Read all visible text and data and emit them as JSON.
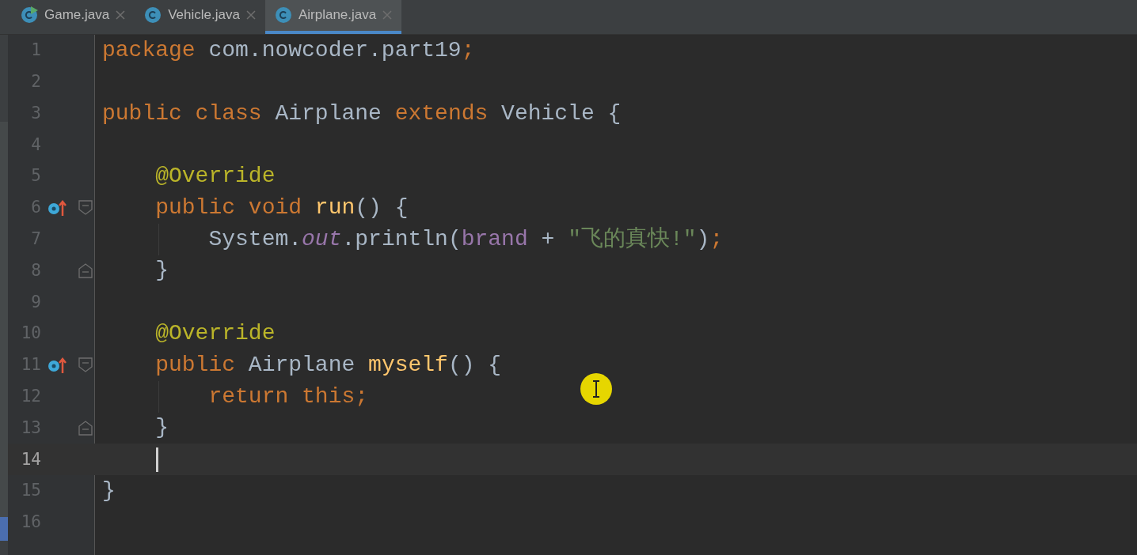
{
  "tabs": [
    {
      "label": "Game.java",
      "kind": "runnable",
      "selected": false
    },
    {
      "label": "Vehicle.java",
      "kind": "class",
      "selected": false
    },
    {
      "label": "Airplane.java",
      "kind": "class",
      "selected": true
    }
  ],
  "editor": {
    "lines": [
      {
        "number": "1",
        "tokens": [
          {
            "text": "package ",
            "kind": "keyword"
          },
          {
            "text": "com.nowcoder.part19",
            "kind": "plain"
          },
          {
            "text": ";",
            "kind": "keyword"
          }
        ]
      },
      {
        "number": "2"
      },
      {
        "number": "3",
        "tokens": [
          {
            "text": "public class ",
            "kind": "keyword"
          },
          {
            "text": "Airplane ",
            "kind": "plain"
          },
          {
            "text": "extends ",
            "kind": "keyword"
          },
          {
            "text": "Vehicle {",
            "kind": "plain"
          }
        ]
      },
      {
        "number": "4"
      },
      {
        "number": "5",
        "tokens": [
          {
            "text": "    @Override",
            "kind": "annotation"
          }
        ]
      },
      {
        "number": "6",
        "override": true,
        "fold_open": true,
        "tokens": [
          {
            "text": "    public void ",
            "kind": "keyword"
          },
          {
            "text": "run",
            "kind": "method"
          },
          {
            "text": "() {",
            "kind": "plain"
          }
        ]
      },
      {
        "number": "7",
        "guide": true,
        "tokens": [
          {
            "text": "        System.",
            "kind": "plain"
          },
          {
            "text": "out",
            "kind": "static"
          },
          {
            "text": ".println(",
            "kind": "plain"
          },
          {
            "text": "brand",
            "kind": "field"
          },
          {
            "text": " + ",
            "kind": "plain"
          },
          {
            "text": "\"飞的真快!\"",
            "kind": "string"
          },
          {
            "text": ")",
            "kind": "plain"
          },
          {
            "text": ";",
            "kind": "keyword"
          }
        ]
      },
      {
        "number": "8",
        "fold_close": true,
        "tokens": [
          {
            "text": "    }",
            "kind": "plain"
          }
        ]
      },
      {
        "number": "9"
      },
      {
        "number": "10",
        "tokens": [
          {
            "text": "    @Override",
            "kind": "annotation"
          }
        ]
      },
      {
        "number": "11",
        "override": true,
        "fold_open": true,
        "tokens": [
          {
            "text": "    public ",
            "kind": "keyword"
          },
          {
            "text": "Airplane ",
            "kind": "plain"
          },
          {
            "text": "myself",
            "kind": "method"
          },
          {
            "text": "() {",
            "kind": "plain"
          }
        ]
      },
      {
        "number": "12",
        "guide": true,
        "tokens": [
          {
            "text": "        return this;",
            "kind": "keyword"
          }
        ]
      },
      {
        "number": "13",
        "fold_close": true,
        "tokens": [
          {
            "text": "    }",
            "kind": "plain"
          }
        ]
      },
      {
        "number": "14",
        "current": true
      },
      {
        "number": "15",
        "tokens": [
          {
            "text": "}",
            "kind": "plain"
          }
        ]
      },
      {
        "number": "16"
      }
    ]
  }
}
